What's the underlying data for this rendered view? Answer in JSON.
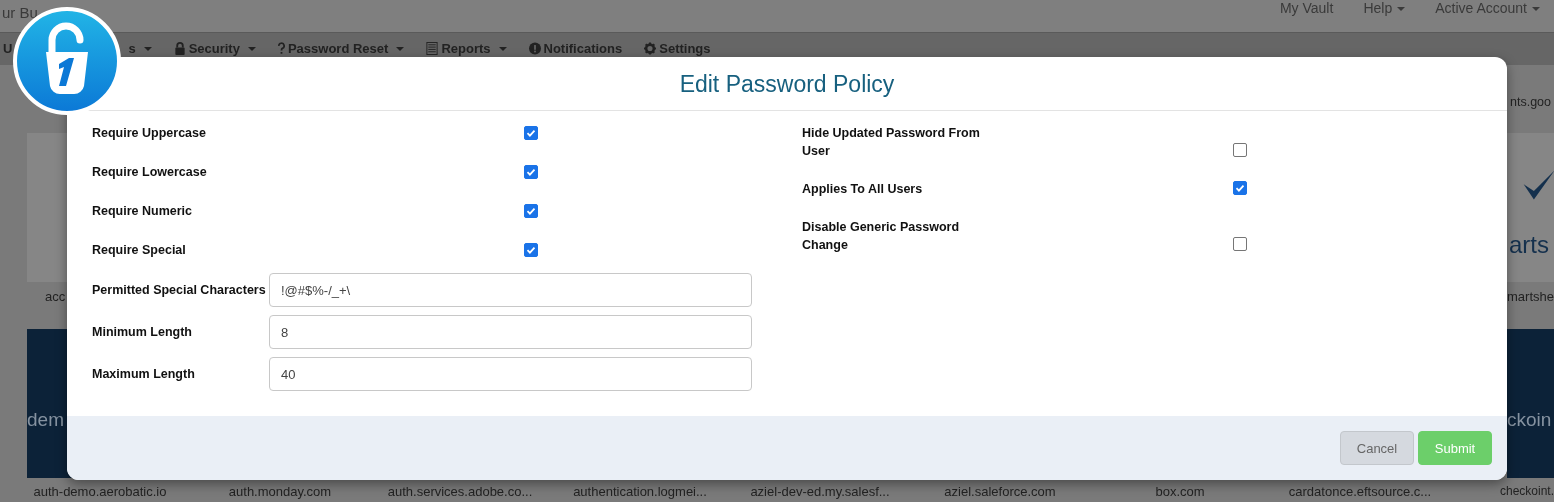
{
  "header": {
    "brand": "ur Bu",
    "links": [
      {
        "label": "My Vault",
        "dropdown": false
      },
      {
        "label": "Help",
        "dropdown": true
      },
      {
        "label": "Active Account",
        "dropdown": true
      }
    ]
  },
  "nav": [
    {
      "label": "U",
      "dropdown": false
    },
    {
      "label": "s",
      "dropdown": true
    },
    {
      "label": "Security",
      "dropdown": true
    },
    {
      "label": "Password Reset",
      "dropdown": true
    },
    {
      "label": "Reports",
      "dropdown": true
    },
    {
      "label": "Notifications",
      "dropdown": false
    },
    {
      "label": "Settings",
      "dropdown": false
    }
  ],
  "background": {
    "top_right_label": "nts.goo",
    "left_tiles": [
      {
        "kind": "light",
        "label": "acc"
      },
      {
        "kind": "dark",
        "logo_text": "dem"
      }
    ],
    "right_tiles": [
      {
        "kind": "light",
        "logo_text": "arts",
        "label": "martshe"
      },
      {
        "kind": "dark",
        "logo_text": "ckoin"
      }
    ],
    "app_labels": [
      "auth-demo.aerobatic.io",
      "auth.monday.com",
      "auth.services.adobe.co...",
      "authentication.logmei...",
      "aziel-dev-ed.my.salesf...",
      "aziel.saleforce.com",
      "box.com",
      "cardatonce.eftsource.c...",
      "checkoint."
    ]
  },
  "dialog": {
    "title": "Edit Password Policy",
    "left_fields": [
      {
        "kind": "checkbox",
        "label": "Require Uppercase",
        "checked": true
      },
      {
        "kind": "checkbox",
        "label": "Require Lowercase",
        "checked": true
      },
      {
        "kind": "checkbox",
        "label": "Require Numeric",
        "checked": true
      },
      {
        "kind": "checkbox",
        "label": "Require Special",
        "checked": true
      },
      {
        "kind": "text",
        "label": "Permitted Special Characters",
        "value": "!@#$%-/_+\\"
      },
      {
        "kind": "text",
        "label": "Minimum Length",
        "value": "8"
      },
      {
        "kind": "text",
        "label": "Maximum Length",
        "value": "40"
      }
    ],
    "right_fields": [
      {
        "kind": "checkbox",
        "label": "Hide Updated Password From User",
        "checked": false
      },
      {
        "kind": "checkbox",
        "label": "Applies To All Users",
        "checked": true
      },
      {
        "kind": "checkbox",
        "label": "Disable Generic Password Change",
        "checked": false
      }
    ],
    "buttons": [
      {
        "label": "Cancel",
        "kind": "secondary"
      },
      {
        "label": "Submit",
        "kind": "primary"
      }
    ]
  }
}
